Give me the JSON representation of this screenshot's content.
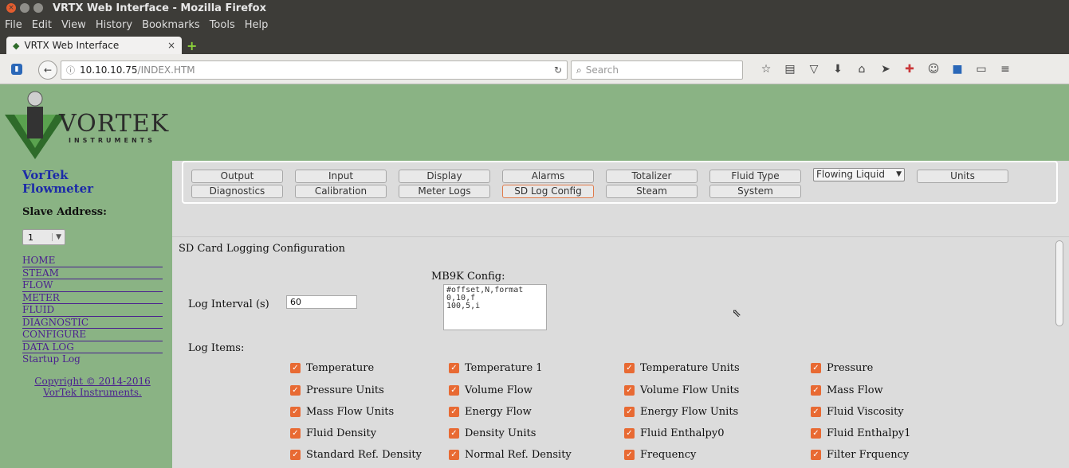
{
  "window": {
    "title": "VRTX Web Interface - Mozilla Firefox"
  },
  "menu": [
    "File",
    "Edit",
    "View",
    "History",
    "Bookmarks",
    "Tools",
    "Help"
  ],
  "tab": {
    "label": "VRTX Web Interface"
  },
  "address": {
    "host": "10.10.10.75",
    "path": "/INDEX.HTM"
  },
  "search": {
    "placeholder": "Search"
  },
  "logo": {
    "name": "VORTEK",
    "sub": "INSTRUMENTS"
  },
  "sidebar": {
    "title_line1": "VorTek",
    "title_line2": "Flowmeter",
    "slave_label": "Slave Address:",
    "slave_value": "1",
    "nav": [
      "HOME",
      "STEAM",
      "FLOW",
      "METER",
      "FLUID",
      "DIAGNOSTIC",
      "CONFIGURE",
      "DATA LOG",
      "Startup Log"
    ],
    "copyright_line1": "Copyright © 2014-2016",
    "copyright_line2": "VorTek Instruments."
  },
  "buttons": {
    "row1": [
      "Output",
      "Input",
      "Display",
      "Alarms",
      "Totalizer",
      "Fluid Type"
    ],
    "select_value": "Flowing Liquid",
    "units": "Units",
    "row2": [
      "Diagnostics",
      "Calibration",
      "Meter Logs",
      "SD Log Config",
      "Steam",
      "System"
    ],
    "active": "SD Log Config"
  },
  "content": {
    "title": "SD Card Logging Configuration",
    "mb9k_label": "MB9K Config:",
    "mb9k_text": "#offset,N,format\n0,10,f\n100,5,i",
    "log_interval_label": "Log Interval (s)",
    "log_interval_value": "60",
    "log_items_label": "Log Items:",
    "items": [
      [
        "Temperature",
        "Temperature 1",
        "Temperature Units",
        "Pressure"
      ],
      [
        "Pressure Units",
        "Volume Flow",
        "Volume Flow Units",
        "Mass Flow"
      ],
      [
        "Mass Flow Units",
        "Energy Flow",
        "Energy Flow Units",
        "Fluid Viscosity"
      ],
      [
        "Fluid Density",
        "Density Units",
        "Fluid Enthalpy0",
        "Fluid Enthalpy1"
      ],
      [
        "Standard Ref. Density",
        "Normal Ref. Density",
        "Frequency",
        "Filter Frquency"
      ]
    ]
  }
}
